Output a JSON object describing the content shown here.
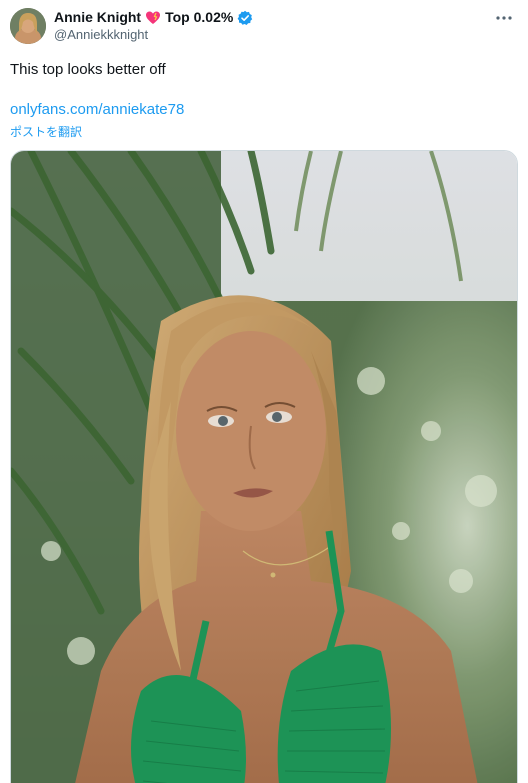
{
  "author": {
    "name": "Annie Knight",
    "badge_text": "Top 0.02%",
    "handle": "@Anniekkknight"
  },
  "tweet": {
    "text": "This top looks better off",
    "link_text": "onlyfans.com/anniekate78",
    "translate_label": "ポストを翻訳"
  },
  "icons": {
    "heart": "heart-icon",
    "verified": "verified-badge-icon",
    "more": "more-options-icon"
  },
  "colors": {
    "link": "#1d9bf0",
    "verified": "#1d9bf0",
    "text": "#0f1419",
    "secondary": "#536471",
    "bikini": "#1f9a5a"
  }
}
